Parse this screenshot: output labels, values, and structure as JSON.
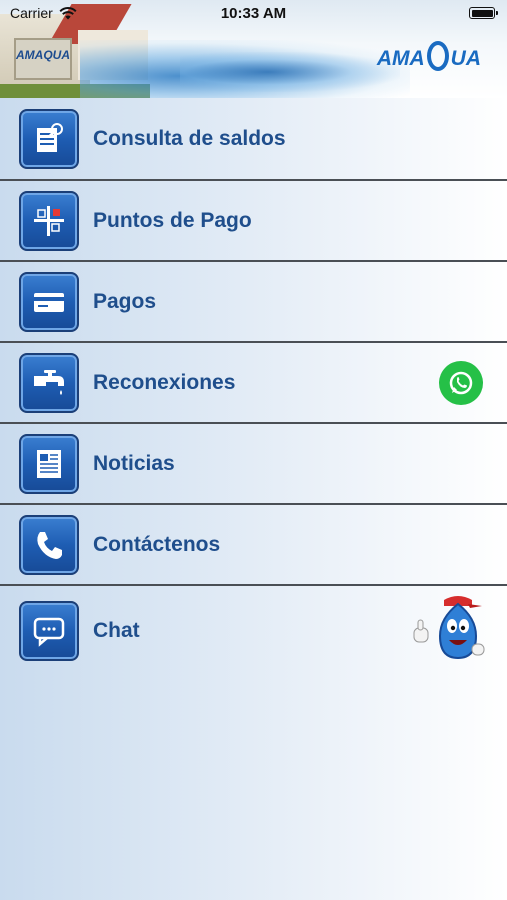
{
  "status_bar": {
    "carrier": "Carrier",
    "time": "10:33 AM",
    "battery_level": 1.0
  },
  "header": {
    "logo_text_left": "AMA",
    "logo_text_right": "UA",
    "sign_text": "AMAQUA"
  },
  "menu": [
    {
      "label": "Consulta de saldos",
      "icon": "document-magnifier-icon"
    },
    {
      "label": "Puntos de Pago",
      "icon": "map-pin-icon"
    },
    {
      "label": "Pagos",
      "icon": "credit-card-icon"
    },
    {
      "label": "Reconexiones",
      "icon": "water-faucet-icon"
    },
    {
      "label": "Noticias",
      "icon": "newspaper-icon"
    },
    {
      "label": "Contáctenos",
      "icon": "phone-icon"
    },
    {
      "label": "Chat",
      "icon": "chat-bubble-icon"
    }
  ],
  "colors": {
    "label": "#1f4e8c",
    "icon_bg": "#1e5db3",
    "whatsapp": "#25c047",
    "logo": "#1a6bc1"
  }
}
